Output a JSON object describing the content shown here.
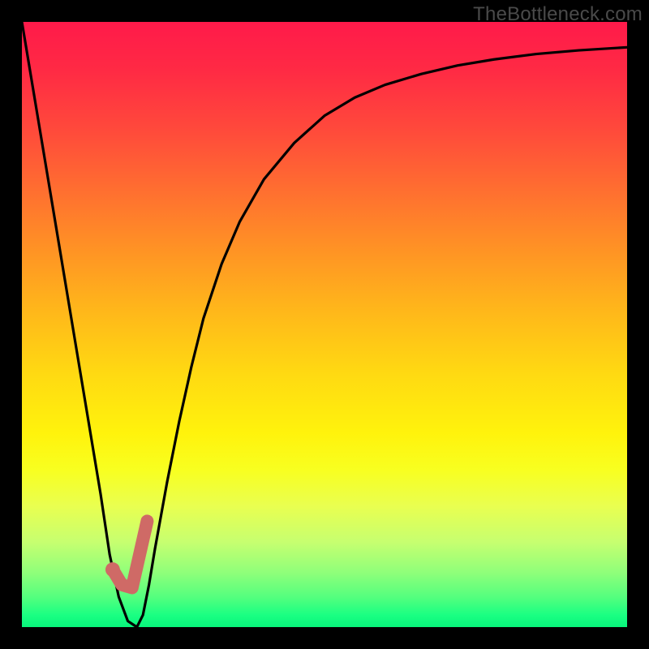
{
  "watermark": "TheBottleneck.com",
  "chart_data": {
    "type": "line",
    "title": "",
    "xlabel": "",
    "ylabel": "",
    "xlim": [
      0,
      100
    ],
    "ylim": [
      0,
      100
    ],
    "series": [
      {
        "name": "bottleneck-curve",
        "x": [
          0,
          3,
          6,
          9,
          11,
          13,
          14.5,
          16,
          17.5,
          19,
          20,
          21,
          22,
          24,
          26,
          28,
          30,
          33,
          36,
          40,
          45,
          50,
          55,
          60,
          66,
          72,
          78,
          85,
          92,
          100
        ],
        "values": [
          100,
          82,
          64,
          46,
          34,
          22,
          12,
          5,
          1,
          0,
          2,
          7,
          13,
          24,
          34,
          43,
          51,
          60,
          67,
          74,
          80,
          84.5,
          87.5,
          89.6,
          91.4,
          92.8,
          93.8,
          94.7,
          95.3,
          95.8
        ]
      }
    ],
    "marker": {
      "name": "optimal-region-marker",
      "color": "#cf6a66",
      "checkmark_path": [
        {
          "x": 15.0,
          "y": 9.5
        },
        {
          "x": 16.5,
          "y": 7.0
        },
        {
          "x": 18.2,
          "y": 6.5
        },
        {
          "x": 20.7,
          "y": 17.5
        }
      ],
      "dot": {
        "x": 15.0,
        "y": 9.5,
        "r": 1.2
      }
    },
    "gradient_stops": [
      {
        "pos": 0,
        "color": "#ff1a4a"
      },
      {
        "pos": 18,
        "color": "#ff4a3b"
      },
      {
        "pos": 38,
        "color": "#ff9424"
      },
      {
        "pos": 58,
        "color": "#ffd912"
      },
      {
        "pos": 74,
        "color": "#f8ff20"
      },
      {
        "pos": 91,
        "color": "#8fff7a"
      },
      {
        "pos": 100,
        "color": "#08f57c"
      }
    ]
  }
}
